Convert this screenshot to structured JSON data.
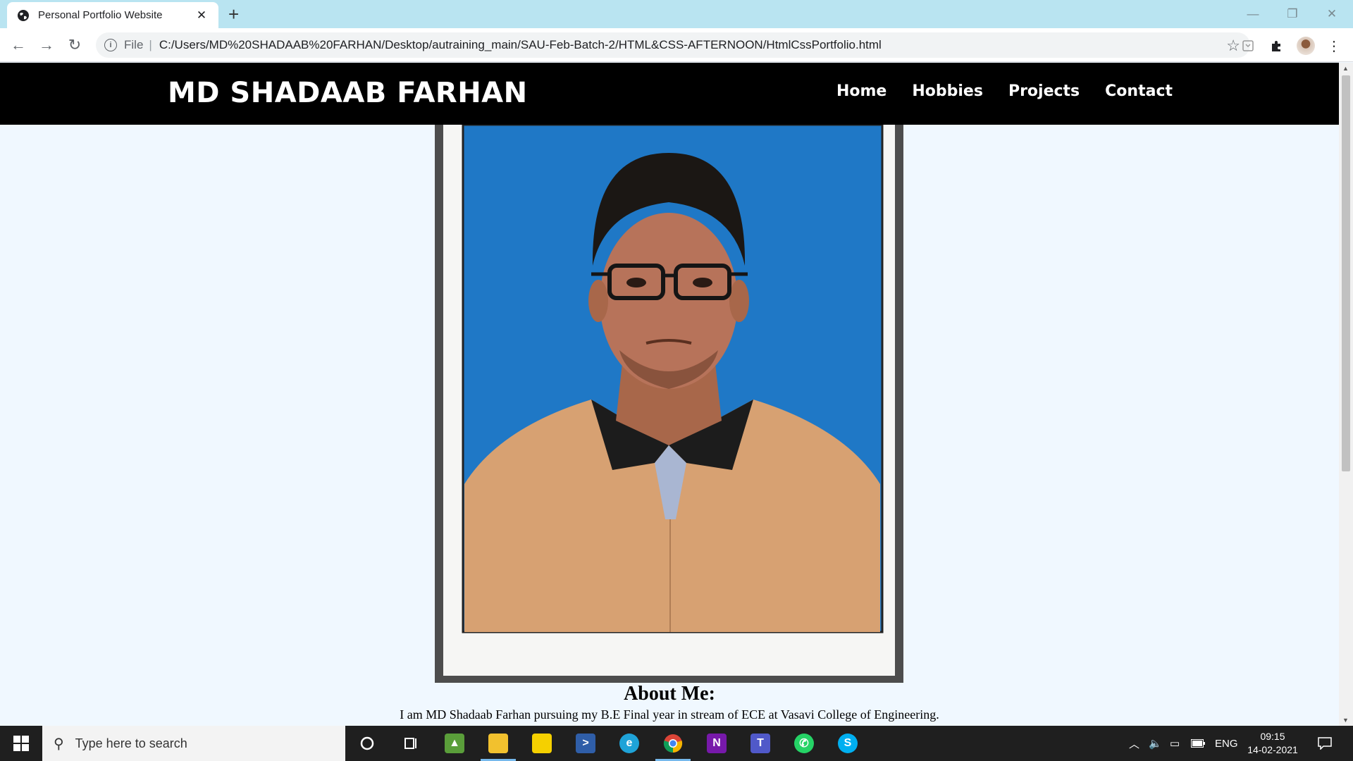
{
  "browser": {
    "tab_title": "Personal Portfolio Website",
    "new_tab": "+",
    "url_scheme": "File",
    "url": "C:/Users/MD%20SHADAAB%20FARHAN/Desktop/autraining_main/SAU-Feb-Batch-2/HTML&CSS-AFTERNOON/HtmlCssPortfolio.html"
  },
  "site": {
    "logo": "MD SHADAAB FARHAN",
    "nav": [
      "Home",
      "Hobbies",
      "Projects",
      "Contact"
    ],
    "about_title": "About Me:",
    "about_text": "I am MD Shadaab Farhan pursuing my B.E Final year in stream of ECE at Vasavi College of Engineering."
  },
  "taskbar": {
    "search_placeholder": "Type here to search",
    "apps": [
      "cortana-icon",
      "task-view-icon",
      "photos-icon",
      "file-explorer-icon",
      "sticky-notes-icon",
      "powershell-icon",
      "edge-icon",
      "chrome-icon",
      "onenote-icon",
      "teams-icon",
      "whatsapp-icon",
      "skype-icon"
    ],
    "language": "ENG",
    "time": "09:15",
    "date": "14-02-2021"
  },
  "colors": {
    "page_bg": "#f0f8ff",
    "header_bg": "#000000",
    "tabstrip_bg": "#b9e4f1"
  }
}
